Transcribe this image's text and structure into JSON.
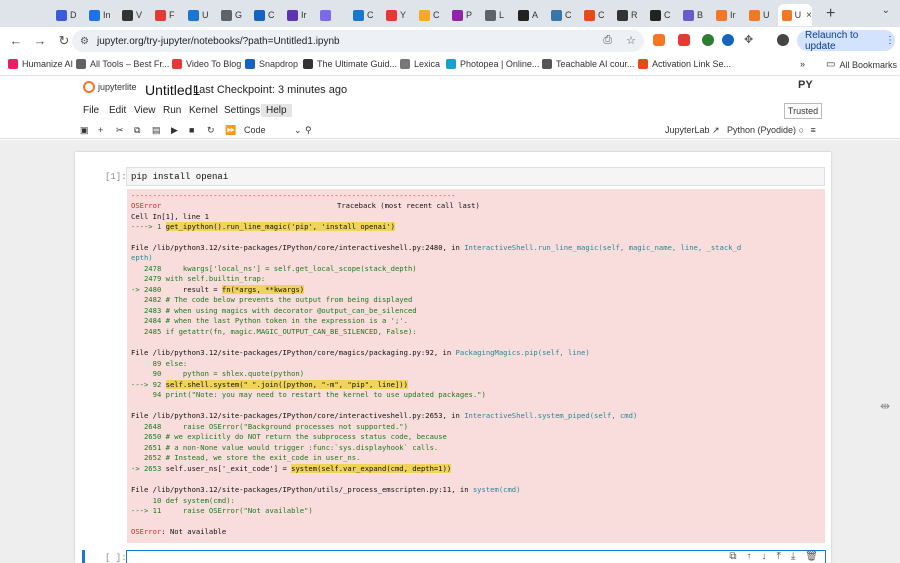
{
  "browser": {
    "tabs": [
      {
        "letter": "D",
        "color": "#3b5bdb"
      },
      {
        "letter": "In",
        "color": "#1a73e8"
      },
      {
        "letter": "V",
        "color": "#333333"
      },
      {
        "letter": "F",
        "color": "#e53935"
      },
      {
        "letter": "U",
        "color": "#1976d2"
      },
      {
        "letter": "G",
        "color": "#5f6368"
      },
      {
        "letter": "C",
        "color": "#1565c0"
      },
      {
        "letter": "Ir",
        "color": "#5e35b1"
      },
      {
        "letter": "",
        "color": "#7b68ee"
      },
      {
        "letter": "C",
        "color": "#1976d2"
      },
      {
        "letter": "Y",
        "color": "#e53935"
      },
      {
        "letter": "C",
        "color": "#f9a825"
      },
      {
        "letter": "P",
        "color": "#8e24aa"
      },
      {
        "letter": "L",
        "color": "#5f6368"
      },
      {
        "letter": "A",
        "color": "#222222"
      },
      {
        "letter": "C",
        "color": "#3776ab"
      },
      {
        "letter": "C",
        "color": "#e64a19"
      },
      {
        "letter": "R",
        "color": "#333333"
      },
      {
        "letter": "C",
        "color": "#222222"
      },
      {
        "letter": "B",
        "color": "#6a5acd"
      },
      {
        "letter": "Ir",
        "color": "#f37726"
      },
      {
        "letter": "U",
        "color": "#f37726"
      },
      {
        "letter": "U",
        "color": "#f37726",
        "active": true
      }
    ],
    "new_tab": "+",
    "url": "jupyter.org/try-jupyter/notebooks/?path=Untitled1.ipynb",
    "relaunch_label": "Relaunch to update",
    "bookmarks": [
      {
        "label": "Humanize AI",
        "color": "#e91e63"
      },
      {
        "label": "All Tools – Best Fr...",
        "color": "#5f6368"
      },
      {
        "label": "Video To Blog",
        "color": "#e53935"
      },
      {
        "label": "Snapdrop",
        "color": "#1565c0"
      },
      {
        "label": "The Ultimate Guid...",
        "color": "#333333"
      },
      {
        "label": "Lexica",
        "color": "#777777"
      },
      {
        "label": "Photopea | Online...",
        "color": "#1a9fd1"
      },
      {
        "label": "Teachable AI cour...",
        "color": "#555555"
      },
      {
        "label": "Activation Link Se...",
        "color": "#e64a19"
      }
    ],
    "more_bookmarks": "»",
    "all_bookmarks": "All Bookmarks"
  },
  "jupyter": {
    "logo_text": "jupyterlite",
    "notebook_title": "Untitled1",
    "checkpoint": "Last Checkpoint: 3 minutes ago",
    "py_logo": "PY",
    "menu": [
      "File",
      "Edit",
      "View",
      "Run",
      "Kernel",
      "Settings",
      "Help"
    ],
    "trusted": "Trusted",
    "cell_type": "Code",
    "kernel_ui": "JupyterLab",
    "kernel_name": "Python (Pyodide)"
  },
  "cells": {
    "first_prompt": "[1]:",
    "first_input": "pip install openai",
    "second_prompt": "[ ]:"
  },
  "traceback": {
    "separator": "---------------------------------------------------------------------------",
    "error_type": "OSError",
    "header_right": "Traceback (most recent call last)",
    "cell_ref": "Cell In[1], line 1",
    "line1_arrow": "----> 1",
    "line1_code": "get_ipython().run_line_magic('pip', 'install openai')",
    "file1": "File /lib/python3.12/site-packages/IPython/core/interactiveshell.py:2480, in",
    "file1_func": "InteractiveShell.run_line_magic(self, magic_name, line, _stack_d",
    "file1_wrap": "epth)",
    "f1_l2478": "   2478     kwargs['local_ns'] = self.get_local_scope(stack_depth)",
    "f1_l2479": "   2479 with self.builtin_trap:",
    "f1_l2480_arrow": "-> 2480",
    "f1_l2480_pre": "     result = ",
    "f1_l2480_hl": "fn(*args, **kwargs)",
    "f1_l2482": "   2482 # The code below prevents the output from being displayed",
    "f1_l2483": "   2483 # when using magics with decorator @output_can_be_silenced",
    "f1_l2484": "   2484 # when the last Python token in the expression is a ';'.",
    "f1_l2485": "   2485 if getattr(fn, magic.MAGIC_OUTPUT_CAN_BE_SILENCED, False):",
    "file2": "File /lib/python3.12/site-packages/IPython/core/magics/packaging.py:92, in",
    "file2_func": "PackagingMagics.pip(self, line)",
    "f2_l89": "     89 else:",
    "f2_l90": "     90     python = shlex.quote(python)",
    "f2_l92_arrow": "---> 92",
    "f2_l92_hl": "self.shell.system(\" \".join([python, \"-m\", \"pip\", line]))",
    "f2_l94": "     94 print(\"Note: you may need to restart the kernel to use updated packages.\")",
    "file3": "File /lib/python3.12/site-packages/IPython/core/interactiveshell.py:2653, in",
    "file3_func": "InteractiveShell.system_piped(self, cmd)",
    "f3_l2648": "   2648     raise OSError(\"Background processes not supported.\")",
    "f3_l2650": "   2650 # we explicitly do NOT return the subprocess status code, because",
    "f3_l2651": "   2651 # a non-None value would trigger :func:`sys.displayhook` calls.",
    "f3_l2652": "   2652 # Instead, we store the exit_code in user_ns.",
    "f3_l2653_arrow": "-> 2653",
    "f3_l2653_pre": " self.user_ns['_exit_code'] = ",
    "f3_l2653_hl": "system(self.var_expand(cmd, depth=1))",
    "file4": "File /lib/python3.12/site-packages/IPython/utils/_process_emscripten.py:11, in",
    "file4_func": "system(cmd)",
    "f4_l10": "     10 def system(cmd):",
    "f4_l11_arrow": "---> 11",
    "f4_l11_code": "     raise OSError(\"Not available\")",
    "final_error": "OSError",
    "final_msg": ": Not available"
  }
}
